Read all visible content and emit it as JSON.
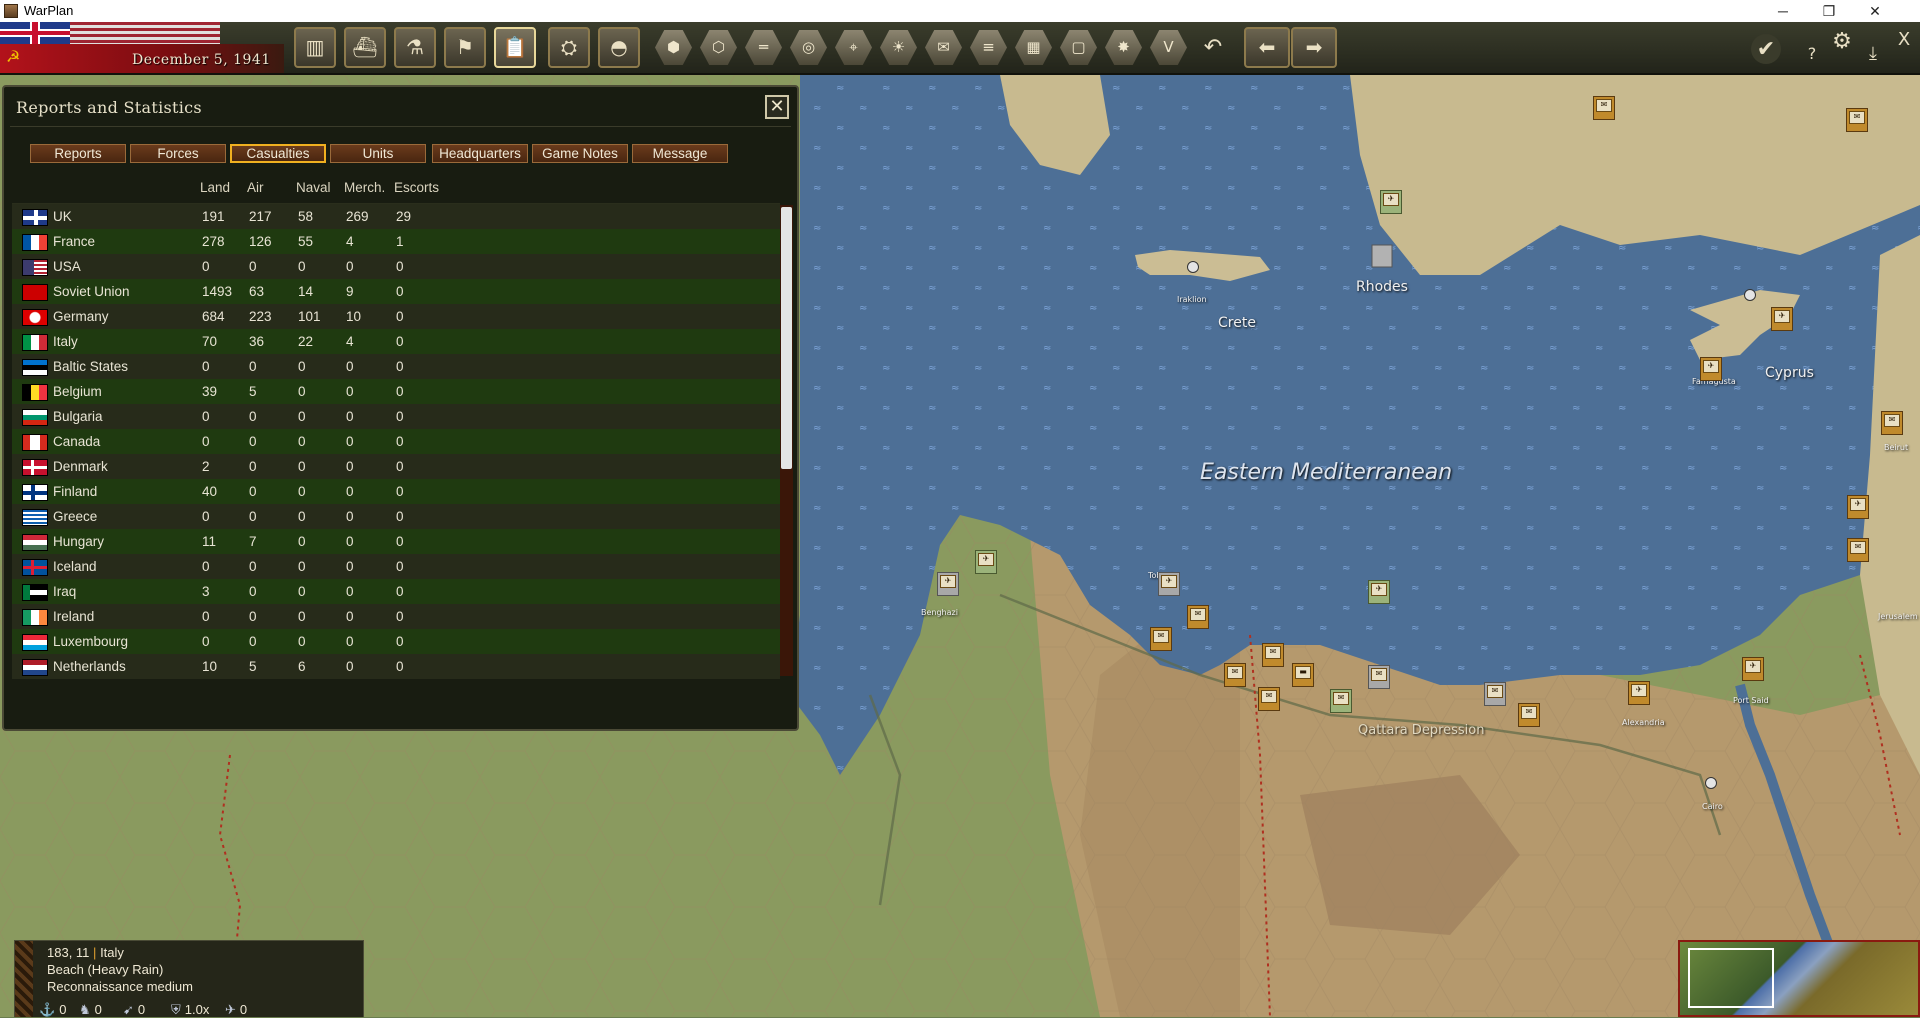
{
  "window": {
    "title": "WarPlan",
    "minimize": "─",
    "restore": "❐",
    "close": "✕"
  },
  "topbar": {
    "date": "December 5, 1941",
    "square_buttons": [
      {
        "name": "production-button",
        "icon": "factory-icon",
        "glyph": "▥"
      },
      {
        "name": "transport-button",
        "icon": "ship-icon",
        "glyph": "⛴"
      },
      {
        "name": "research-button",
        "icon": "microscope-icon",
        "glyph": "⚗"
      },
      {
        "name": "diplomacy-button",
        "icon": "flag-icon",
        "glyph": "⚑"
      },
      {
        "name": "reports-button",
        "icon": "clipboard-icon",
        "glyph": "📋"
      },
      {
        "name": "intelligence-button",
        "icon": "binoculars-icon",
        "glyph": "⛭"
      },
      {
        "name": "units-button",
        "icon": "helmet-icon",
        "glyph": "◓"
      }
    ],
    "hex_buttons": [
      {
        "name": "hex-grid-toggle",
        "icon": "hexagon-icon",
        "glyph": "⬢"
      },
      {
        "name": "hex-supply-toggle",
        "icon": "hex-cluster-icon",
        "glyph": "⬡"
      },
      {
        "name": "rail-toggle",
        "icon": "rail-icon",
        "glyph": "═"
      },
      {
        "name": "resources-toggle",
        "icon": "coins-icon",
        "glyph": "◎"
      },
      {
        "name": "target-toggle",
        "icon": "crosshair-icon",
        "glyph": "⌖"
      },
      {
        "name": "weather-toggle",
        "icon": "sun-icon",
        "glyph": "☀"
      },
      {
        "name": "hq-toggle",
        "icon": "envelope-icon",
        "glyph": "✉"
      },
      {
        "name": "road-toggle",
        "icon": "road-icon",
        "glyph": "≡"
      },
      {
        "name": "zoc-toggle",
        "icon": "grid-icon",
        "glyph": "▦"
      },
      {
        "name": "frame-toggle",
        "icon": "square-frame-icon",
        "glyph": "▢"
      },
      {
        "name": "combat-toggle",
        "icon": "explosion-icon",
        "glyph": "✸"
      },
      {
        "name": "victory-toggle",
        "icon": "v-icon",
        "glyph": "V"
      }
    ],
    "nav": {
      "undo_glyph": "↶",
      "prev_glyph": "⬅",
      "next_glyph": "➡",
      "confirm_glyph": "✔",
      "help_glyph": "?",
      "settings_glyph": "⚙",
      "save_glyph": "⤓",
      "exit_glyph": "X"
    }
  },
  "reports": {
    "title": "Reports and Statistics",
    "close_glyph": "✕",
    "tabs": [
      "Reports",
      "Forces",
      "Casualties",
      "Units",
      "Headquarters",
      "Game Notes",
      "Message"
    ],
    "active_tab": "Casualties",
    "columns": [
      "Land",
      "Air",
      "Naval",
      "Merch.",
      "Escorts"
    ],
    "rows": [
      {
        "country": "UK",
        "land": "191",
        "air": "217",
        "naval": "58",
        "merch": "269",
        "escorts": "29",
        "flag": "uk"
      },
      {
        "country": "France",
        "land": "278",
        "air": "126",
        "naval": "55",
        "merch": "4",
        "escorts": "1",
        "flag": "fr"
      },
      {
        "country": "USA",
        "land": "0",
        "air": "0",
        "naval": "0",
        "merch": "0",
        "escorts": "0",
        "flag": "us"
      },
      {
        "country": "Soviet Union",
        "land": "1493",
        "air": "63",
        "naval": "14",
        "merch": "9",
        "escorts": "0",
        "flag": "su"
      },
      {
        "country": "Germany",
        "land": "684",
        "air": "223",
        "naval": "101",
        "merch": "10",
        "escorts": "0",
        "flag": "de"
      },
      {
        "country": "Italy",
        "land": "70",
        "air": "36",
        "naval": "22",
        "merch": "4",
        "escorts": "0",
        "flag": "it"
      },
      {
        "country": "Baltic States",
        "land": "0",
        "air": "0",
        "naval": "0",
        "merch": "0",
        "escorts": "0",
        "flag": "ee"
      },
      {
        "country": "Belgium",
        "land": "39",
        "air": "5",
        "naval": "0",
        "merch": "0",
        "escorts": "0",
        "flag": "be"
      },
      {
        "country": "Bulgaria",
        "land": "0",
        "air": "0",
        "naval": "0",
        "merch": "0",
        "escorts": "0",
        "flag": "bg"
      },
      {
        "country": "Canada",
        "land": "0",
        "air": "0",
        "naval": "0",
        "merch": "0",
        "escorts": "0",
        "flag": "ca"
      },
      {
        "country": "Denmark",
        "land": "2",
        "air": "0",
        "naval": "0",
        "merch": "0",
        "escorts": "0",
        "flag": "dk"
      },
      {
        "country": "Finland",
        "land": "40",
        "air": "0",
        "naval": "0",
        "merch": "0",
        "escorts": "0",
        "flag": "fi"
      },
      {
        "country": "Greece",
        "land": "0",
        "air": "0",
        "naval": "0",
        "merch": "0",
        "escorts": "0",
        "flag": "gr"
      },
      {
        "country": "Hungary",
        "land": "11",
        "air": "7",
        "naval": "0",
        "merch": "0",
        "escorts": "0",
        "flag": "hu"
      },
      {
        "country": "Iceland",
        "land": "0",
        "air": "0",
        "naval": "0",
        "merch": "0",
        "escorts": "0",
        "flag": "is"
      },
      {
        "country": "Iraq",
        "land": "3",
        "air": "0",
        "naval": "0",
        "merch": "0",
        "escorts": "0",
        "flag": "iq"
      },
      {
        "country": "Ireland",
        "land": "0",
        "air": "0",
        "naval": "0",
        "merch": "0",
        "escorts": "0",
        "flag": "ie"
      },
      {
        "country": "Luxembourg",
        "land": "0",
        "air": "0",
        "naval": "0",
        "merch": "0",
        "escorts": "0",
        "flag": "lu"
      },
      {
        "country": "Netherlands",
        "land": "10",
        "air": "5",
        "naval": "6",
        "merch": "0",
        "escorts": "0",
        "flag": "nl"
      }
    ]
  },
  "map": {
    "sea_label": "Eastern Mediterranean",
    "labels": [
      {
        "name": "map-label-crete",
        "text": "Crete"
      },
      {
        "name": "map-label-rhodes",
        "text": "Rhodes"
      },
      {
        "name": "map-label-cyprus",
        "text": "Cyprus"
      },
      {
        "name": "map-label-qattara",
        "text": "Qattara Depression"
      },
      {
        "name": "map-label-iraklion",
        "text": "Iraklion"
      },
      {
        "name": "map-label-tobruk",
        "text": "Tobruk"
      },
      {
        "name": "map-label-alexandria",
        "text": "Alexandria"
      },
      {
        "name": "map-label-cairo",
        "text": "Cairo"
      },
      {
        "name": "map-label-port-said",
        "text": "Port Said"
      },
      {
        "name": "map-label-jerusalem",
        "text": "Jerusalem"
      },
      {
        "name": "map-label-benghazi",
        "text": "Benghazi"
      },
      {
        "name": "map-label-famagusta",
        "text": "Famagusta"
      },
      {
        "name": "map-label-beirut",
        "text": "Beirut"
      }
    ]
  },
  "info": {
    "coords": "183, 11",
    "separator": "|",
    "country": "Italy",
    "terrain": "Beach (Heavy Rain)",
    "recon": "Reconnaissance medium",
    "stats": [
      {
        "icon": "anchor-icon",
        "glyph": "⚓",
        "value": "0"
      },
      {
        "icon": "soldier-icon",
        "glyph": "♞",
        "value": "0"
      },
      {
        "icon": "artillery-icon",
        "glyph": "➹",
        "value": "0"
      },
      {
        "icon": "shield-icon",
        "glyph": "⛨",
        "value": "1.0x"
      },
      {
        "icon": "plane-icon",
        "glyph": "✈",
        "value": "0"
      }
    ]
  },
  "colors": {
    "sea": "#4d6f96",
    "desert": "#b5996d",
    "land": "#8a9a5f",
    "accent": "#f0b020"
  }
}
